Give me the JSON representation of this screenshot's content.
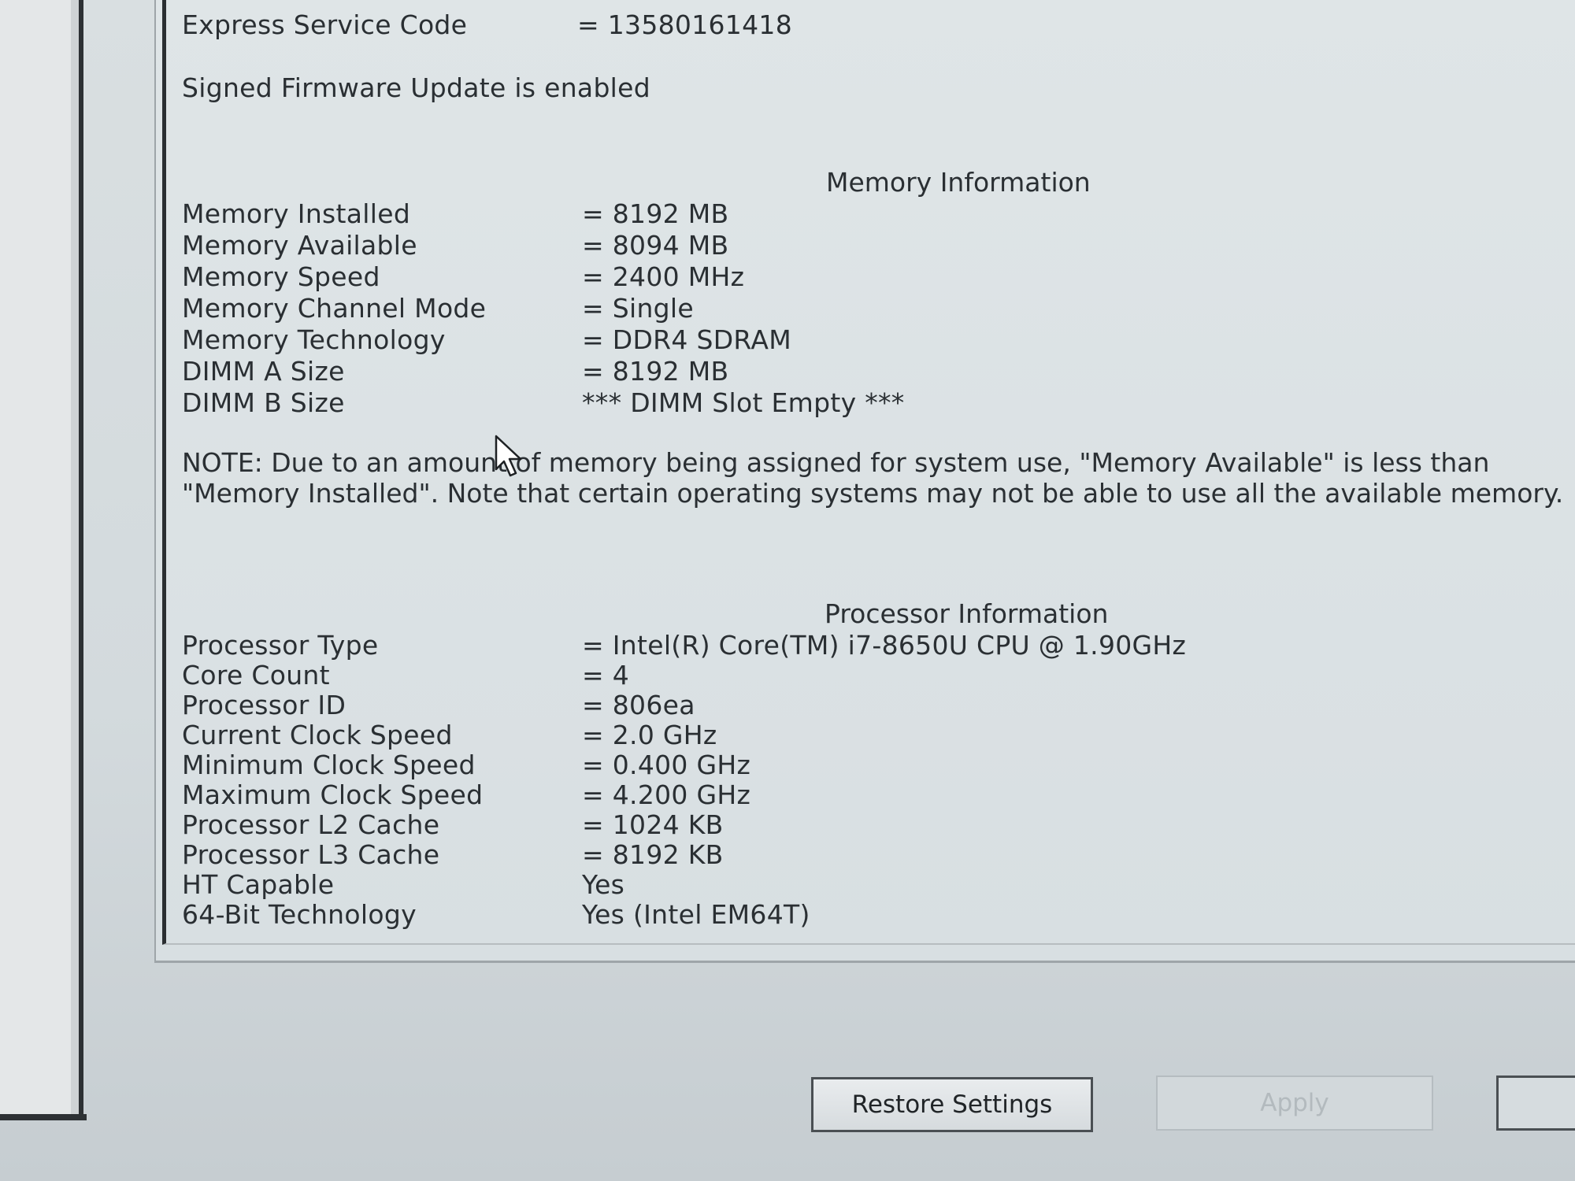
{
  "header": {
    "express_service_code_label": "Express Service Code",
    "express_service_code_value": "= 13580161418",
    "firmware_status": "Signed Firmware Update is enabled"
  },
  "memory": {
    "title": "Memory Information",
    "rows": [
      {
        "label": "Memory Installed",
        "value": "= 8192 MB"
      },
      {
        "label": "Memory Available",
        "value": "= 8094 MB"
      },
      {
        "label": "Memory Speed",
        "value": "= 2400 MHz"
      },
      {
        "label": "Memory Channel Mode",
        "value": "= Single"
      },
      {
        "label": "Memory Technology",
        "value": "= DDR4 SDRAM"
      },
      {
        "label": "DIMM A Size",
        "value": "= 8192 MB"
      },
      {
        "label": "DIMM B Size",
        "value": "*** DIMM Slot Empty ***"
      }
    ],
    "note": "NOTE: Due to an amount of memory being assigned for system use, \"Memory Available\" is less than \"Memory Installed\". Note that certain operating systems may not be able to use all the available memory."
  },
  "processor": {
    "title": "Processor Information",
    "rows": [
      {
        "label": "Processor Type",
        "value": "= Intel(R) Core(TM) i7-8650U CPU @ 1.90GHz"
      },
      {
        "label": "Core Count",
        "value": "= 4"
      },
      {
        "label": "Processor ID",
        "value": "= 806ea"
      },
      {
        "label": "Current Clock Speed",
        "value": "= 2.0 GHz"
      },
      {
        "label": "Minimum Clock Speed",
        "value": "= 0.400 GHz"
      },
      {
        "label": "Maximum Clock Speed",
        "value": "= 4.200 GHz"
      },
      {
        "label": "Processor L2 Cache",
        "value": "= 1024 KB"
      },
      {
        "label": "Processor L3 Cache",
        "value": "= 8192 KB"
      },
      {
        "label": "HT Capable",
        "value": "Yes"
      },
      {
        "label": "64-Bit Technology",
        "value": "Yes (Intel EM64T)"
      }
    ]
  },
  "footer": {
    "restore_label": "Restore Settings",
    "apply_label": "Apply"
  },
  "icons": {
    "cursor": "mouse-pointer-icon"
  }
}
